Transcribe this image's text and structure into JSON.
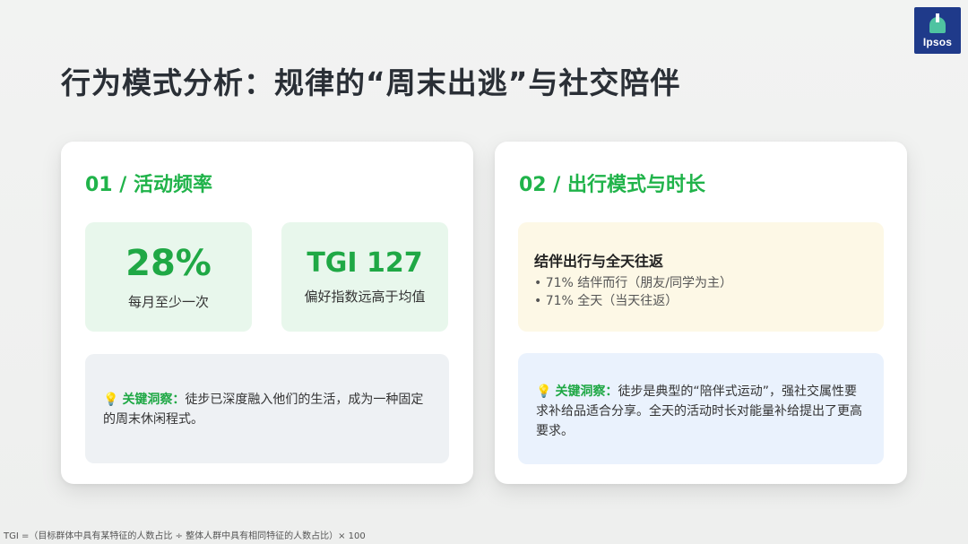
{
  "logo": {
    "text": "Ipsos",
    "brand_color": "#1f3a8a"
  },
  "title": "行为模式分析：规律的“周末出逃”与社交陪伴",
  "accent_color": "#1fa845",
  "left_card": {
    "heading": "01 / 活动频率",
    "stats": [
      {
        "value": "28%",
        "label": "每月至少一次"
      },
      {
        "value": "TGI 127",
        "label": "偏好指数远高于均值"
      }
    ],
    "insight": {
      "icon": "lightbulb-icon",
      "key": "关键洞察：",
      "text": "徒步已深度融入他们的生活，成为一种固定的周末休闲程式。"
    }
  },
  "right_card": {
    "heading": "02 / 出行模式与时长",
    "mode": {
      "title": "结伴出行与全天往返",
      "items": [
        "• 71% 结伴而行（朋友/同学为主）",
        "• 71% 全天（当天往返）"
      ]
    },
    "insight": {
      "icon": "lightbulb-icon",
      "key": "关键洞察：",
      "text": "徒步是典型的“陪伴式运动”，强社交属性要求补给品适合分享。全天的活动时长对能量补给提出了更高要求。"
    }
  },
  "footnote": "TGI =（目标群体中具有某特征的人数占比 ÷ 整体人群中具有相同特征的人数占比）× 100"
}
